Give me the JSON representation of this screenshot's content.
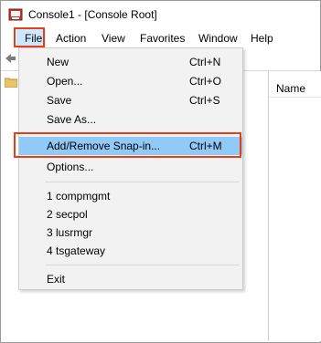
{
  "window": {
    "title": "Console1 - [Console Root]",
    "app_icon": "mmc-console-icon"
  },
  "menubar": {
    "items": [
      "File",
      "Action",
      "View",
      "Favorites",
      "Window",
      "Help"
    ]
  },
  "results_pane": {
    "column_header": "Name"
  },
  "file_menu": {
    "items": [
      {
        "label": "New",
        "shortcut": "Ctrl+N"
      },
      {
        "label": "Open...",
        "shortcut": "Ctrl+O"
      },
      {
        "label": "Save",
        "shortcut": "Ctrl+S"
      },
      {
        "label": "Save As...",
        "shortcut": ""
      },
      {
        "label": "Add/Remove Snap-in...",
        "shortcut": "Ctrl+M"
      },
      {
        "label": "Options...",
        "shortcut": ""
      },
      {
        "label": "1 compmgmt",
        "shortcut": ""
      },
      {
        "label": "2 secpol",
        "shortcut": ""
      },
      {
        "label": "3 lusrmgr",
        "shortcut": ""
      },
      {
        "label": "4 tsgateway",
        "shortcut": ""
      },
      {
        "label": "Exit",
        "shortcut": ""
      }
    ]
  },
  "colors": {
    "highlight_box": "#e2401a",
    "menu_hover": "#91c9f7",
    "file_menu_active": "#cce8ff",
    "menu_background": "#f2f2f2"
  }
}
